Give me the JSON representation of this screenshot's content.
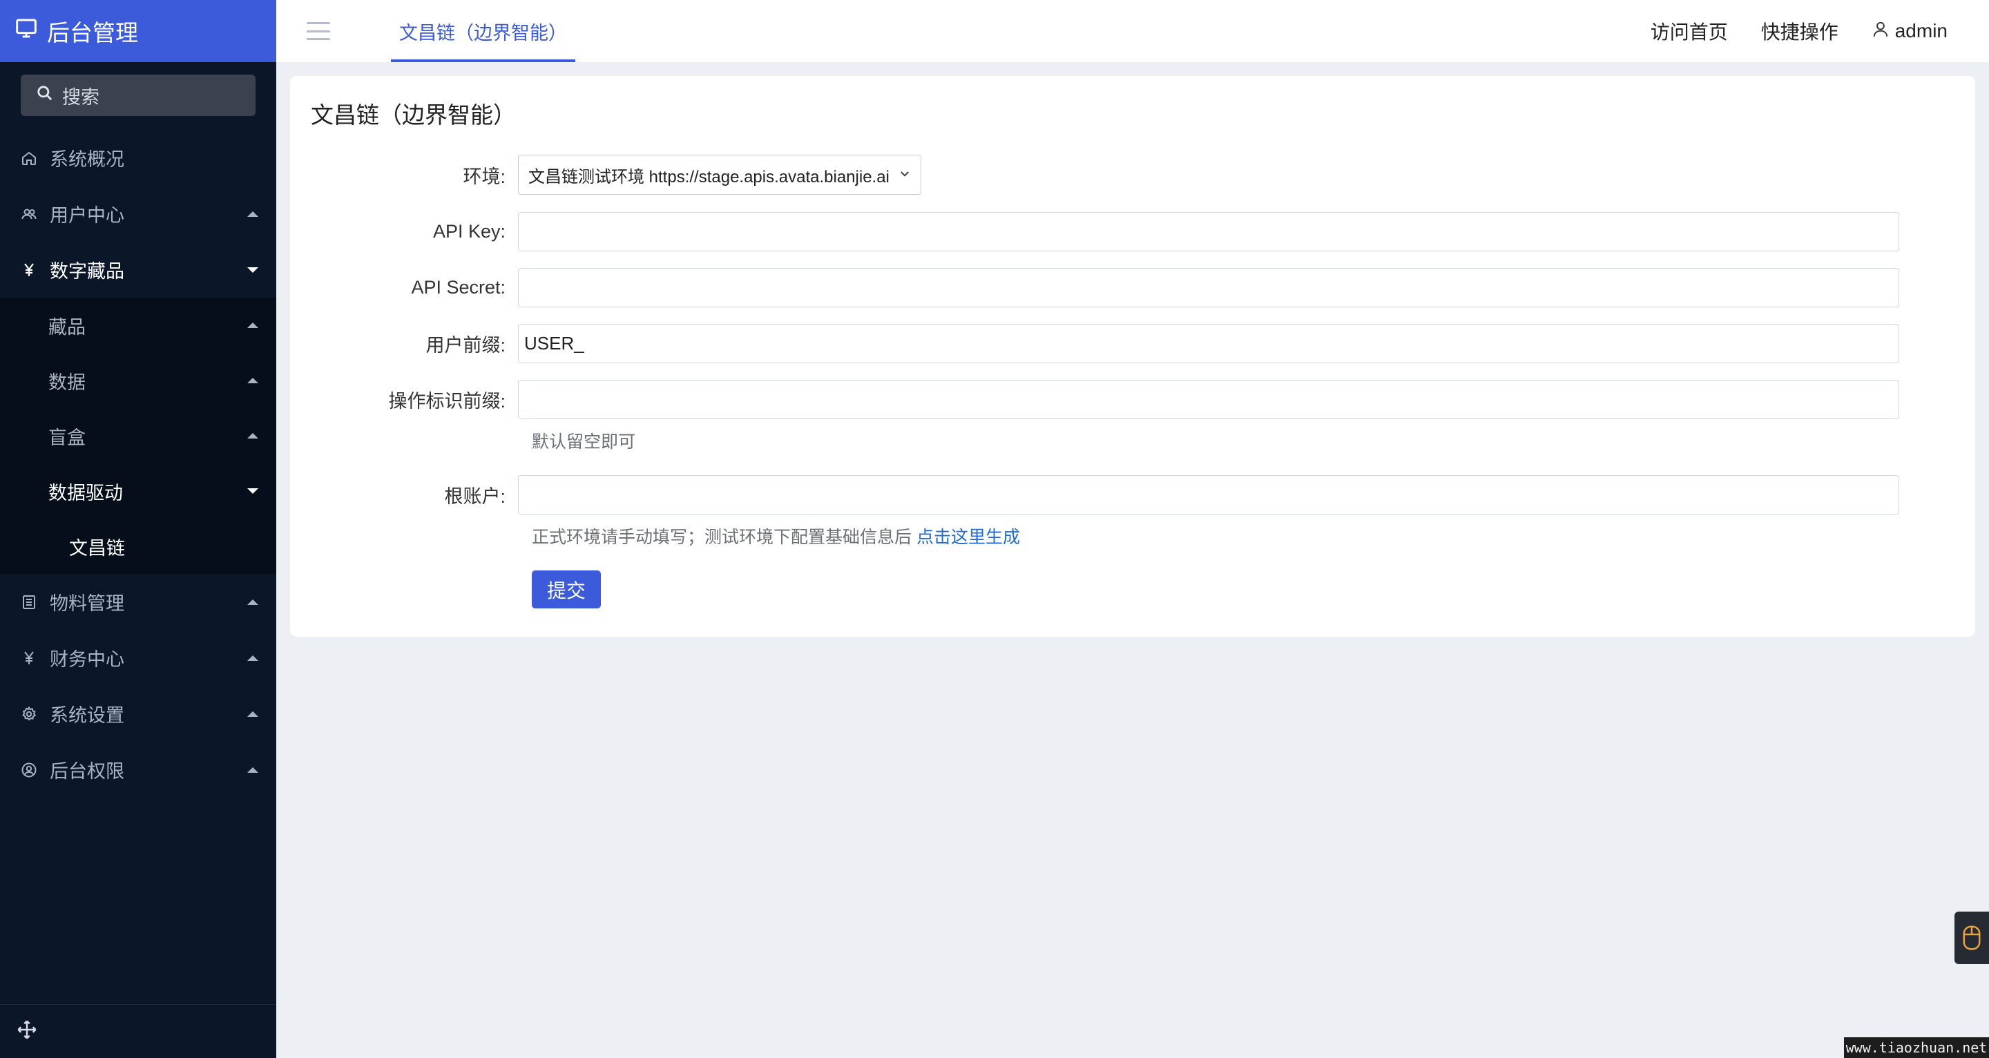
{
  "sidebar": {
    "brand": "后台管理",
    "search_label": "搜索",
    "items": [
      {
        "label": "系统概况"
      },
      {
        "label": "用户中心"
      },
      {
        "label": "数字藏品"
      },
      {
        "label": "藏品"
      },
      {
        "label": "数据"
      },
      {
        "label": "盲盒"
      },
      {
        "label": "数据驱动"
      },
      {
        "label": "文昌链"
      },
      {
        "label": "物料管理"
      },
      {
        "label": "财务中心"
      },
      {
        "label": "系统设置"
      },
      {
        "label": "后台权限"
      }
    ]
  },
  "topbar": {
    "active_tab": "文昌链（边界智能）",
    "visit_home": "访问首页",
    "quick_ops": "快捷操作",
    "user": "admin"
  },
  "form": {
    "title": "文昌链（边界智能）",
    "env_label": "环境:",
    "env_value": "文昌链测试环境 https://stage.apis.avata.bianjie.ai",
    "api_key_label": "API Key:",
    "api_key_value": "",
    "api_secret_label": "API Secret:",
    "api_secret_value": "",
    "user_prefix_label": "用户前缀:",
    "user_prefix_value": "USER_",
    "op_prefix_label": "操作标识前缀:",
    "op_prefix_value": "",
    "op_prefix_hint": "默认留空即可",
    "root_account_label": "根账户:",
    "root_account_value": "",
    "root_hint": "正式环境请手动填写；测试环境下配置基础信息后 ",
    "root_hint_link": "点击这里生成",
    "submit": "提交"
  },
  "watermark": "www.tiaozhuan.net",
  "colors": {
    "accent": "#3b5bdb",
    "sidebar_bg": "#0c1629",
    "link": "#1f6bd6"
  }
}
